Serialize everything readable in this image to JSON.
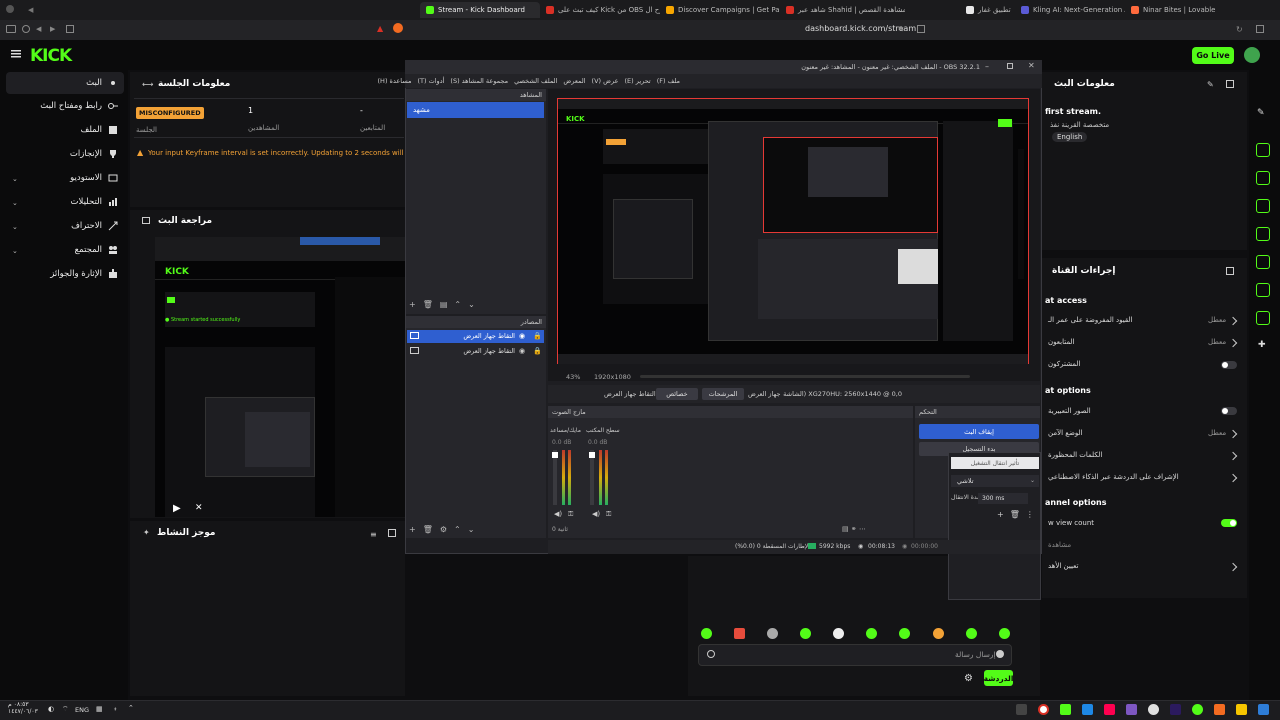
{
  "browser": {
    "tabs": [
      {
        "label": "تطبيق غفار",
        "color": "#e8e8e8"
      },
      {
        "label": "Kling AI: Next-Generation AI Creative",
        "color": "#5b5bd6"
      },
      {
        "label": "Ninar Bites | Lovable",
        "color": "#ff6a3d"
      },
      {
        "label": "شاهد عبر Shahid | مشاهدة القصص",
        "color": "#d93025"
      },
      {
        "label": "Discover Campaigns | Get Paid for Po...",
        "color": "#f7a600"
      },
      {
        "label": "كيف تبث على Kick من OBS الشرح ال...",
        "color": "#d93025"
      },
      {
        "label": "Stream - Kick Dashboard",
        "color": "#53fc18"
      }
    ],
    "url": "dashboard.kick.com/stream"
  },
  "kick": {
    "logo": "KICK",
    "go_live": "Go Live",
    "nav": [
      {
        "label": "البث",
        "icon": "broadcast-icon",
        "active": true
      },
      {
        "label": "رابط ومفتاح البث",
        "icon": "key-icon"
      },
      {
        "label": "الملف",
        "icon": "file-icon"
      },
      {
        "label": "الإنجازات",
        "icon": "trophy-icon"
      },
      {
        "label": "الاستوديو",
        "icon": "studio-icon"
      },
      {
        "label": "التحليلات",
        "icon": "chart-icon"
      },
      {
        "label": "الاحتراف",
        "icon": "pro-icon"
      },
      {
        "label": "المجتمع",
        "icon": "community-icon"
      },
      {
        "label": "الإثارة والجوائز",
        "icon": "rewards-icon"
      }
    ],
    "session": {
      "title": "معلومات الجلسة",
      "status_badge": "MISCONFIGURED",
      "status_label": "الجلسة",
      "viewers_value": "1",
      "viewers_label": "المشاهدين",
      "followers_value": "-",
      "followers_label": "المتابعين",
      "warning": "Your input Keyframe interval is set incorrectly. Updating to 2 seconds will redu"
    },
    "preview": {
      "title": "مراجعة البث"
    },
    "activity": {
      "title": "موجز النشاط"
    },
    "stream_info": {
      "title": "معلومات البث",
      "stream_title": "first stream.",
      "category_label": "متخصصة القرينة نفذ",
      "language": "English"
    },
    "actions": {
      "title": "إجراءات القناة",
      "section_access": "at access",
      "rows": [
        {
          "label": "القيود المفروضة على عمر الـ",
          "value": "معطل"
        },
        {
          "label": "المتابعون",
          "value": "معطل"
        },
        {
          "label": "المشتركون",
          "value": ""
        }
      ],
      "section_chat": "at options",
      "chat_rows": [
        {
          "label": "الصور التعبيرية",
          "value": ""
        },
        {
          "label": "الوضع الآمن",
          "value": "معطل"
        },
        {
          "label": "الكلمات المحظورة",
          "value": ""
        },
        {
          "label": "الإشراف على الدردشة عبر الذكاء الاصطناعي",
          "value": ""
        }
      ],
      "section_channel": "annel options",
      "channel_rows": [
        {
          "label": "w view count",
          "value": ""
        },
        {
          "label": "مشاهدة",
          "value": ""
        },
        {
          "label": "تعيين الأهد",
          "value": ""
        }
      ]
    },
    "chat": {
      "placeholder": "إرسال رسالة",
      "send": "الدردشة"
    }
  },
  "obs": {
    "title": "OBS 32.2.1 - الملف الشخصي: غير معنون - المشاهد: غير معنون",
    "menu": [
      "ملف (F)",
      "تحرير (E)",
      "عرض (V)",
      "المعرض",
      "الملف الشخصي",
      "مجموعة المشاهد (S)",
      "أدوات (T)",
      "مساعدة (H)"
    ],
    "scenes_title": "المشاهد",
    "scene": "مشهد",
    "sources_title": "المصادر",
    "sources": [
      "التقاط جهاز العرض",
      "التقاط جهاز العرض"
    ],
    "zoom": "43%",
    "resolution": "1920x1080",
    "display_label": "جهاز العرض",
    "display_value": "XG270HU: 2560x1440 @ 0,0 (الشاشة الأساسية)",
    "filters_btn": "المرشحات",
    "props_btn": "خصائص",
    "capture_label": "التقاط جهاز العرض",
    "mixer_title": "مازج الصوت",
    "mixer_channels": [
      {
        "name": "مايك/مساعد",
        "db": "0.0 dB"
      },
      {
        "name": "سطح المكتب",
        "db": "0.0 dB"
      }
    ],
    "transitions_value": "ثانية 0",
    "controls_title": "التحكم",
    "controls": {
      "start_stream": "إيقاف البث",
      "start_record": "بدء التسجيل",
      "studio_mode": "تأثير انتقال التشغيل",
      "fade": "تلاشي",
      "duration": "300 ms",
      "duration_label": "مدة الانتقال"
    },
    "status": {
      "dropped": "الإطارات المسقطة 0 (0.0%)",
      "bitrate": "5992 kbps",
      "live_time": "00:08:13",
      "rec_time": "00:00:00"
    }
  },
  "taskbar": {
    "lang": "ENG",
    "time": "٠٨:٥٣ م",
    "date": "١٤٤٧/٠٦/٠٣"
  }
}
